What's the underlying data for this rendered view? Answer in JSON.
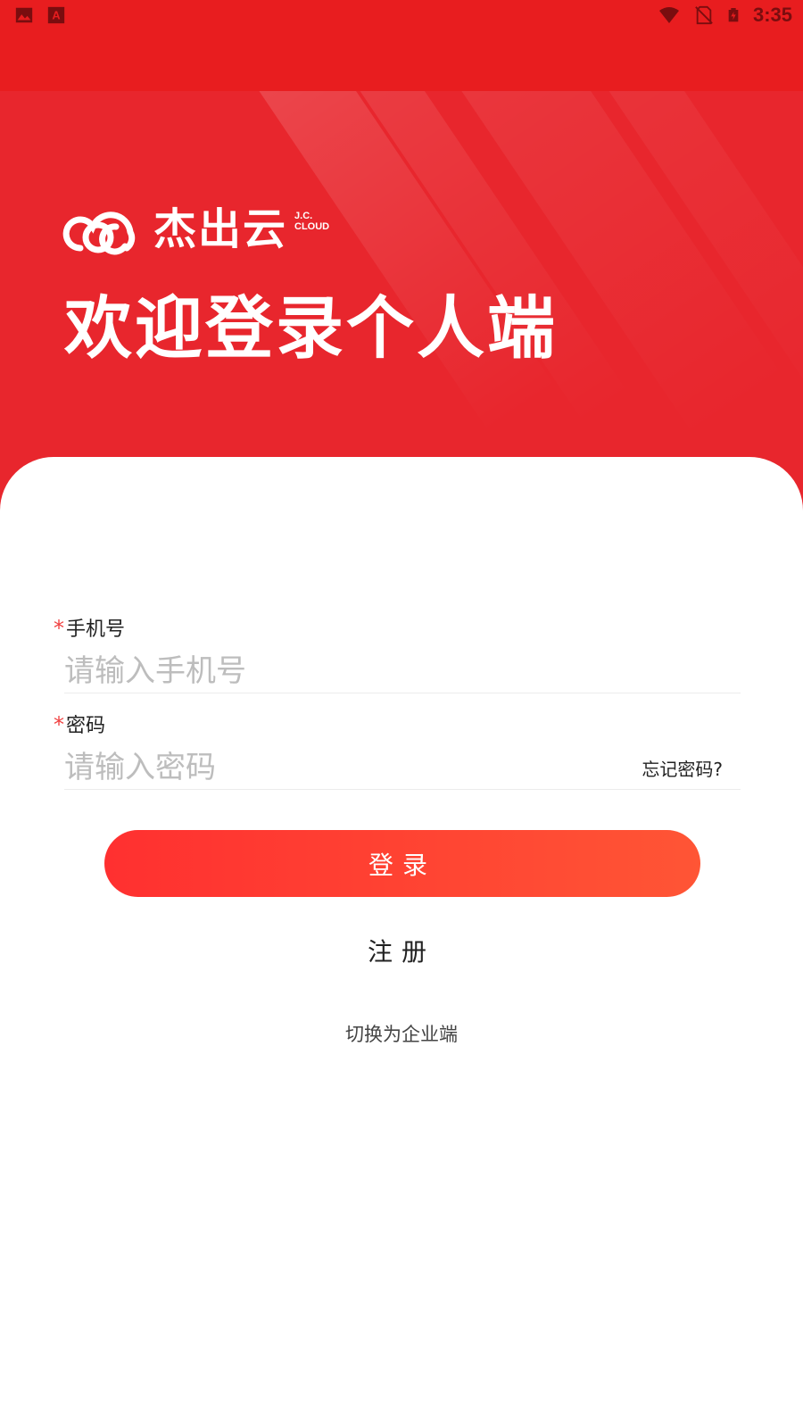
{
  "status_bar": {
    "time": "3:35",
    "icons": [
      "image-icon",
      "text-a-icon",
      "wifi-icon",
      "no-sim-icon",
      "battery-charging-icon"
    ]
  },
  "brand": {
    "name": "杰出云",
    "en_line1": "J.C.",
    "en_line2": "CLOUD"
  },
  "welcome_title": "欢迎登录个人端",
  "phone": {
    "required_mark": "*",
    "label": "手机号",
    "placeholder": "请输入手机号",
    "value": ""
  },
  "password": {
    "required_mark": "*",
    "label": "密码",
    "placeholder": "请输入密码",
    "value": "",
    "forgot_label": "忘记密码?"
  },
  "login_button": "登录",
  "register_link": "注册",
  "switch_link": "切换为企业端",
  "colors": {
    "primary": "#e8262d",
    "button_start": "#ff3030",
    "button_end": "#ff5535"
  }
}
